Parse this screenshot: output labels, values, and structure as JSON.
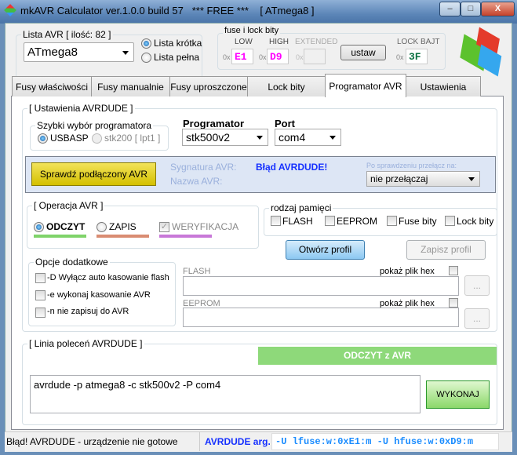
{
  "window": {
    "title": "mkAVR Calculator ver.1.0.0 build 57   *** FREE ***    [ ATmega8 ]",
    "min": "–",
    "max": "□",
    "close": "X"
  },
  "avr_list": {
    "title": "Lista AVR [ ilość: 82 ]",
    "selected": "ATmega8",
    "radio_short": "Lista krótka",
    "radio_full": "Lista pełna"
  },
  "fuses": {
    "title": "fuse i lock bity",
    "prefix": "0x",
    "low_label": "LOW",
    "low": "E1",
    "high_label": "HIGH",
    "high": "D9",
    "ext_label": "EXTENDED",
    "ext": "",
    "set_button": "ustaw",
    "lock_label": "LOCK BAJT",
    "lock": "3F"
  },
  "tabs": [
    "Fusy właściwości",
    "Fusy manualnie",
    "Fusy uproszczone",
    "Lock bity",
    "Programator AVR",
    "Ustawienia"
  ],
  "avrdude_settings": {
    "title": "[ Ustawienia AVRDUDE ]",
    "quick_title": "Szybki wybór programatora",
    "quick_usbasp": "USBASP",
    "quick_stk200": "stk200 [ lpt1 ]",
    "programmer_label": "Programator",
    "programmer": "stk500v2",
    "port_label": "Port",
    "port": "com4"
  },
  "check": {
    "button": "Sprawdź podłączony AVR",
    "signature_label": "Sygnatura AVR:",
    "name_label": "Nazwa AVR:",
    "status": "Błąd AVRDUDE!",
    "switch_label": "Po sprawdzeniu przełącz na:",
    "switch_value": "nie przełączaj"
  },
  "operation": {
    "title": "[ Operacja AVR ]",
    "read": "ODCZYT",
    "write": "ZAPIS",
    "verify": "WERYFIKACJA",
    "colors": {
      "read": "#7fd36a",
      "write": "#d98c72",
      "verify": "#c878d8"
    }
  },
  "memory": {
    "title": "rodzaj pamięci",
    "flash": "FLASH",
    "eeprom": "EEPROM",
    "fuse": "Fuse bity",
    "lock": "Lock bity"
  },
  "profile": {
    "open": "Otwórz profil",
    "save": "Zapisz profil"
  },
  "options": {
    "title": "Opcje dodatkowe",
    "opt_d": "-D Wyłącz auto kasowanie flash",
    "opt_e": "-e wykonaj kasowanie AVR",
    "opt_n": "-n nie zapisuj do AVR"
  },
  "files": {
    "flash_label": "FLASH",
    "eeprom_label": "EEPROM",
    "show_hex": "pokaż plik hex",
    "flash_value": "",
    "eeprom_value": "",
    "browse": "..."
  },
  "cmdline": {
    "title": "[ Linia poleceń AVRDUDE ]",
    "mode": "ODCZYT z AVR",
    "command": "avrdude -p atmega8 -c stk500v2 -P com4",
    "execute": "WYKONAJ"
  },
  "status": {
    "message": "Błąd! AVRDUDE - urządzenie nie gotowe",
    "args_label": "AVRDUDE arg.",
    "args": "-U lfuse:w:0xE1:m  -U hfuse:w:0xD9:m"
  }
}
